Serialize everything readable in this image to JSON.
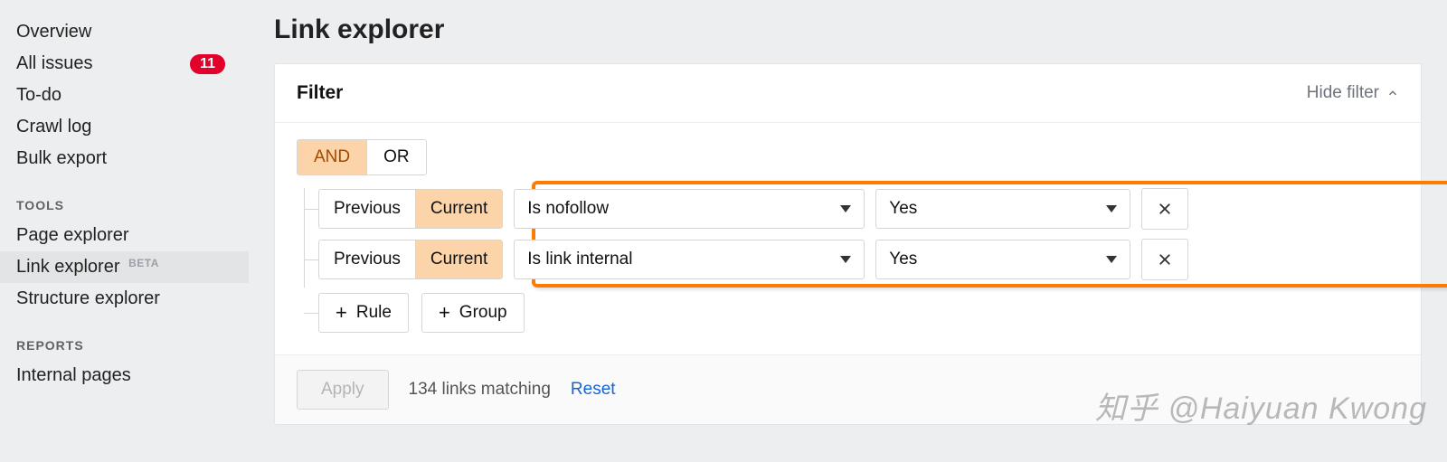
{
  "sidebar": {
    "items": [
      {
        "label": "Overview"
      },
      {
        "label": "All issues",
        "badge": "11"
      },
      {
        "label": "To-do"
      },
      {
        "label": "Crawl log"
      },
      {
        "label": "Bulk export"
      }
    ],
    "tools_header": "TOOLS",
    "tools": [
      {
        "label": "Page explorer"
      },
      {
        "label": "Link explorer",
        "beta": "BETA",
        "active": true
      },
      {
        "label": "Structure explorer"
      }
    ],
    "reports_header": "REPORTS",
    "reports": [
      {
        "label": "Internal pages"
      }
    ]
  },
  "page": {
    "title": "Link explorer"
  },
  "filter": {
    "title": "Filter",
    "hide_label": "Hide filter",
    "logic": {
      "and": "AND",
      "or": "OR",
      "selected": "AND"
    },
    "rows": [
      {
        "prev": "Previous",
        "cur": "Current",
        "field": "Is nofollow",
        "value": "Yes"
      },
      {
        "prev": "Previous",
        "cur": "Current",
        "field": "Is link internal",
        "value": "Yes"
      }
    ],
    "add_rule": "Rule",
    "add_group": "Group",
    "apply": "Apply",
    "matching": "134 links matching",
    "reset": "Reset"
  },
  "watermark": "知乎 @Haiyuan Kwong"
}
